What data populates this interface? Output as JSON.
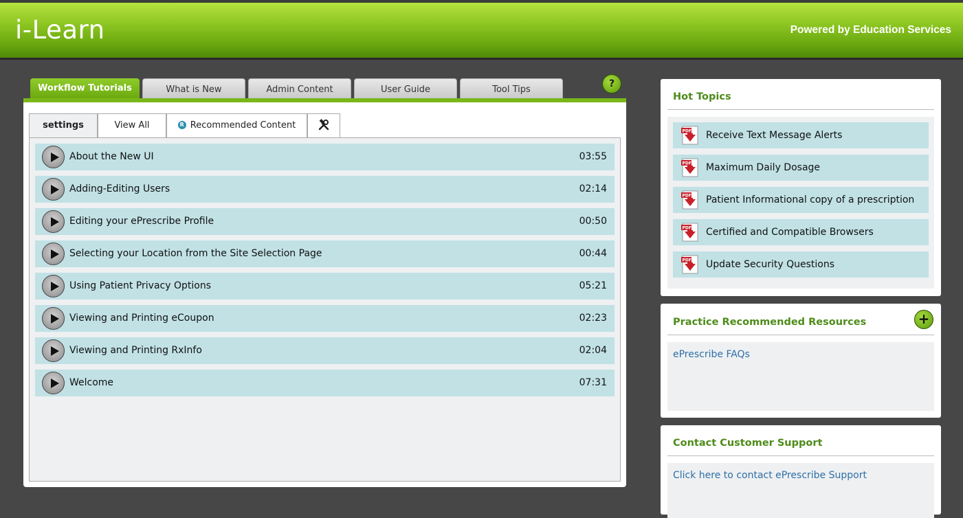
{
  "header": {
    "logo": "i-Learn",
    "powered_by": "Powered by Education Services"
  },
  "main_tabs": [
    {
      "label": "Workflow Tutorials",
      "active": true
    },
    {
      "label": "What is New",
      "active": false
    },
    {
      "label": "Admin Content",
      "active": false
    },
    {
      "label": "User Guide",
      "active": false
    },
    {
      "label": "Tool Tips",
      "active": false
    }
  ],
  "help_icon": "?",
  "sub_tabs": {
    "settings": "settings",
    "view_all": "View All",
    "recommended": "Recommended Content",
    "recommended_badge": "R",
    "tools_icon": "wrench-hammer-icon"
  },
  "videos": [
    {
      "title": "About the New UI",
      "duration": "03:55"
    },
    {
      "title": "Adding-Editing Users",
      "duration": "02:14"
    },
    {
      "title": "Editing your ePrescribe Profile",
      "duration": "00:50"
    },
    {
      "title": "Selecting your Location from the Site Selection Page",
      "duration": "00:44"
    },
    {
      "title": "Using Patient Privacy Options",
      "duration": "05:21"
    },
    {
      "title": "Viewing and Printing eCoupon",
      "duration": "02:23"
    },
    {
      "title": "Viewing and Printing RxInfo",
      "duration": "02:04"
    },
    {
      "title": "Welcome",
      "duration": "07:31"
    }
  ],
  "hot_topics": {
    "title": "Hot Topics",
    "items": [
      "Receive Text Message Alerts",
      "Maximum Daily Dosage",
      "Patient Informational copy of a prescription",
      "Certified and Compatible Browsers",
      "Update Security Questions"
    ]
  },
  "practice_resources": {
    "title": "Practice Recommended Resources",
    "add_icon": "+",
    "links": [
      "ePrescribe FAQs"
    ]
  },
  "support": {
    "title": "Contact Customer Support",
    "link": "Click here to contact ePrescribe Support"
  },
  "colors": {
    "brand_green": "#79b71a",
    "row_blue": "#c1e1e5",
    "heading_green": "#4e8c1a",
    "link_blue": "#2f6fa8"
  }
}
